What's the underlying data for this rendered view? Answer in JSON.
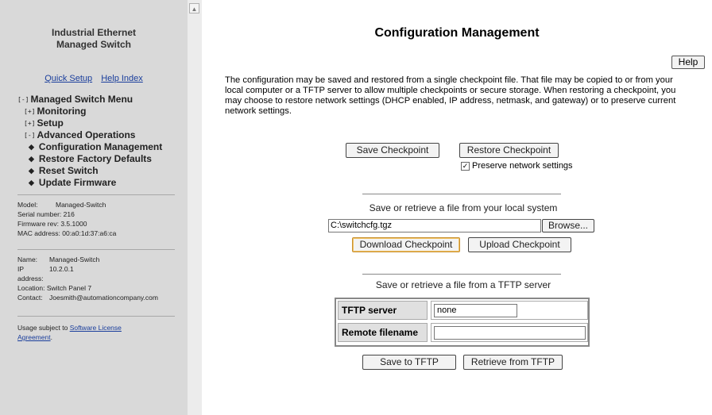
{
  "sidebar": {
    "title_line1": "Industrial Ethernet",
    "title_line2": "Managed Switch",
    "links": [
      "Quick Setup",
      "Help Index"
    ],
    "menu": {
      "root_toggle": "[-]",
      "root": "Managed Switch Menu",
      "monitoring_toggle": "[+]",
      "monitoring": "Monitoring",
      "setup_toggle": "[+]",
      "setup": "Setup",
      "advanced_toggle": "[-]",
      "advanced": "Advanced Operations",
      "items": [
        "Configuration Management",
        "Restore Factory Defaults",
        "Reset Switch",
        "Update Firmware"
      ]
    },
    "device": {
      "model_label": "Model:",
      "model": "Managed-Switch",
      "serial_label": "Serial number:",
      "serial": "216",
      "firmware_label": "Firmware rev:",
      "firmware": "3.5.1000",
      "mac_label": "MAC address:",
      "mac": "00:a0:1d:37:a6:ca"
    },
    "site": {
      "name_label": "Name:",
      "name": "Managed-Switch",
      "ip_label_1": "IP",
      "ip_label_2": "address:",
      "ip": "10.2.0.1",
      "location_label": "Location:",
      "location": "Switch Panel 7",
      "contact_label": "Contact:",
      "contact": "Joesmith@automationcompany.com"
    },
    "license": {
      "prefix": "Usage subject to ",
      "link_line1": "Software License",
      "link_line2": "Agreement",
      "suffix": "."
    }
  },
  "main": {
    "title": "Configuration Management",
    "help_label": "Help",
    "description": "The configuration may be saved and restored from a single checkpoint file. That file may be copied to or from your local computer or a TFTP server to allow multiple checkpoints or secure storage. When restoring a checkpoint, you may choose to restore network settings (DHCP enabled, IP address, netmask, and gateway) or to preserve current network settings.",
    "save_checkpoint": "Save Checkpoint",
    "restore_checkpoint": "Restore Checkpoint",
    "preserve_label": "Preserve network settings",
    "preserve_checked": true,
    "local": {
      "caption": "Save or retrieve a file from your local system",
      "file_value": "C:\\switchcfg.tgz",
      "browse_label": "Browse...",
      "download_label": "Download Checkpoint",
      "upload_label": "Upload Checkpoint"
    },
    "tftp": {
      "caption": "Save or retrieve a file from a TFTP server",
      "server_label": "TFTP server",
      "server_value": "none",
      "filename_label": "Remote filename",
      "filename_value": "",
      "save_label": "Save to TFTP",
      "retrieve_label": "Retrieve from TFTP"
    }
  }
}
